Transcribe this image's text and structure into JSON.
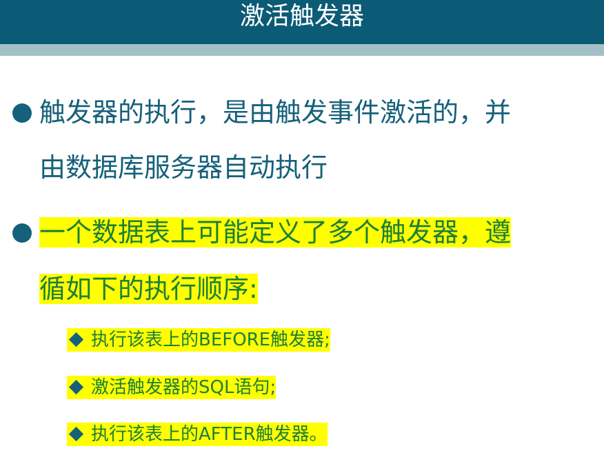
{
  "header": {
    "title": "激活触发器"
  },
  "bullets": [
    {
      "lines": [
        "触发器的执行，是由触发事件激活的，并",
        "由数据库服务器自动执行"
      ]
    },
    {
      "lines": [
        "一个数据表上可能定义了多个触发器，遵",
        "循如下的执行顺序:"
      ]
    }
  ],
  "sub_items": [
    "执行该表上的BEFORE触发器;",
    "激活触发器的SQL语句;",
    "执行该表上的AFTER触发器。"
  ],
  "colors": {
    "title_bar": "#0b5b76",
    "title_stripe": "#a3c0c6",
    "bullet_text": "#15607a",
    "highlight": "#ffff00",
    "highlight_text": "#1c7f39"
  },
  "icons": {
    "bullet": "filled-circle",
    "sub_bullet": "filled-diamond"
  }
}
